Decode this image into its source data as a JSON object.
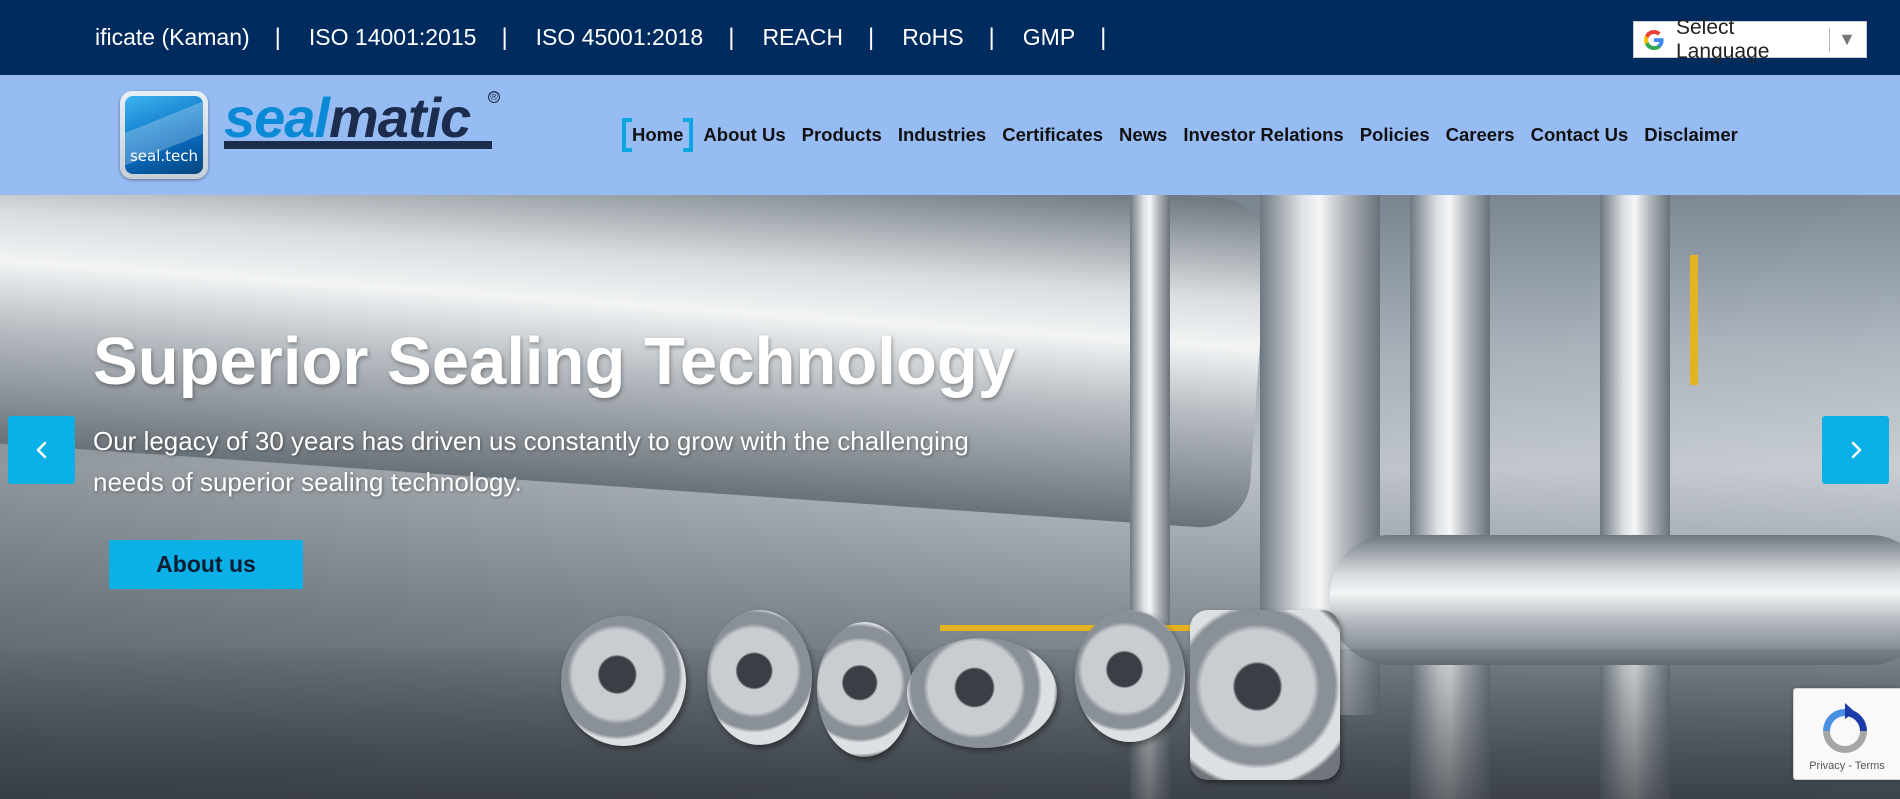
{
  "topbar": {
    "certifications": [
      "ificate (Kaman)",
      "ISO 14001:2015",
      "ISO 45001:2018",
      "REACH",
      "RoHS",
      "GMP"
    ],
    "separator": "|",
    "language_select": {
      "label": "Select Language",
      "arrow": "▼"
    }
  },
  "header": {
    "logo": {
      "badge_text": "seal.tech",
      "word_part1": "seal",
      "word_part2": "matic",
      "reg_mark": "®"
    },
    "nav": [
      {
        "label": "Home",
        "active": true
      },
      {
        "label": "About Us"
      },
      {
        "label": "Products"
      },
      {
        "label": "Industries"
      },
      {
        "label": "Certificates"
      },
      {
        "label": "News"
      },
      {
        "label": "Investor Relations"
      },
      {
        "label": "Policies"
      },
      {
        "label": "Careers"
      },
      {
        "label": "Contact Us"
      },
      {
        "label": "Disclaimer"
      }
    ]
  },
  "hero": {
    "title": "Superior Sealing Technology",
    "subtitle": "Our legacy of 30 years has driven us constantly to grow with the challenging needs of superior sealing technology.",
    "cta_label": "About us",
    "prev_icon": "chevron-left-icon",
    "next_icon": "chevron-right-icon"
  },
  "recaptcha": {
    "privacy": "Privacy",
    "separator": " - ",
    "terms": "Terms"
  },
  "colors": {
    "topbar_bg": "#002b5e",
    "header_bg": "#97bcf4",
    "accent": "#0ab0e6",
    "logo_blue": "#0a8ad6",
    "logo_navy": "#1c2c4c"
  }
}
